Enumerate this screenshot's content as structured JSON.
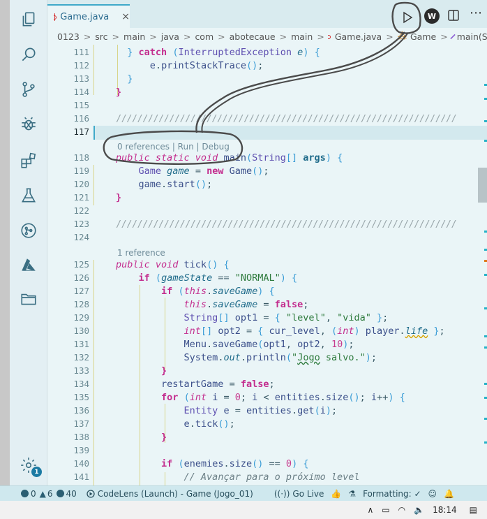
{
  "tab": {
    "label": "Game.java",
    "close": "×"
  },
  "breadcrumb": {
    "items": [
      "0123",
      "src",
      "main",
      "java",
      "com",
      "abotecaue",
      "main",
      "Game.java",
      "Game",
      "main(String[])"
    ],
    "separator": ">"
  },
  "editor": {
    "code_lens": {
      "main": "0 references | Run | Debug",
      "tick": "1 reference"
    },
    "line_numbers": [
      "111",
      "112",
      "113",
      "114",
      "115",
      "116",
      "117",
      "118",
      "119",
      "120",
      "121",
      "122",
      "123",
      "124",
      "125",
      "126",
      "127",
      "128",
      "129",
      "130",
      "131",
      "132",
      "133",
      "134",
      "135",
      "136",
      "137",
      "138",
      "139",
      "140",
      "141"
    ],
    "current_line": "117",
    "hatch": "////////////////////////////////////////////////////////////////"
  },
  "toolbar": {
    "wallaby": "W",
    "more": "⋯"
  },
  "settings": {
    "badge": "1"
  },
  "statusbar": {
    "errors": "0",
    "warnings": "6",
    "info": "40",
    "launch": "CodeLens (Launch) - Game (Jogo_01)",
    "golive": "Go Live",
    "formatting": "Formatting: ✓"
  },
  "taskbar": {
    "time": "18:14"
  },
  "colors": {
    "accent": "#3fa9c9",
    "keyword": "#c32d8e",
    "string": "#2d7a3c"
  }
}
